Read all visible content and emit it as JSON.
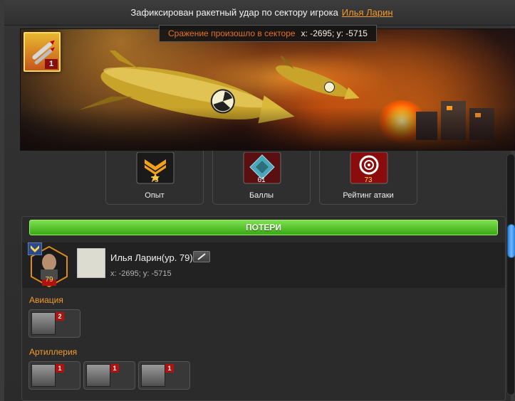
{
  "header": {
    "title": "Зафиксирован ракетный удар по сектору игрока",
    "player_link": "Илья Ларин"
  },
  "banner": {
    "sector_label": "Сражение произошло в секторе",
    "sector_coords": "x: -2695; y: -5715",
    "missile_badge_count": "1"
  },
  "stats": [
    {
      "label": "Опыт",
      "value": "73",
      "icon": "sergeant-rank-icon"
    },
    {
      "label": "Баллы",
      "value": "61",
      "icon": "diamond-points-icon"
    },
    {
      "label": "Рейтинг атаки",
      "value": "73",
      "icon": "target-icon"
    }
  ],
  "losses": {
    "header": "ПОТЕРИ",
    "player": {
      "name": "Илья Ларин(ур. 79)",
      "level": "79",
      "coords": "x: -2695; y: -5715"
    },
    "categories": [
      {
        "name": "Авиация",
        "units": [
          {
            "count": "2",
            "icon": "aircraft-unit-icon"
          }
        ]
      },
      {
        "name": "Артиллерия",
        "units": [
          {
            "count": "1",
            "icon": "artillery-unit-icon"
          },
          {
            "count": "1",
            "icon": "artillery-unit-icon"
          },
          {
            "count": "1",
            "icon": "artillery-unit-icon"
          }
        ]
      }
    ]
  },
  "colors": {
    "accent_orange": "#f39b2b",
    "losses_green": "#4bbf1f",
    "count_red": "#b01212",
    "scroll_blue": "#3a8ee8"
  }
}
